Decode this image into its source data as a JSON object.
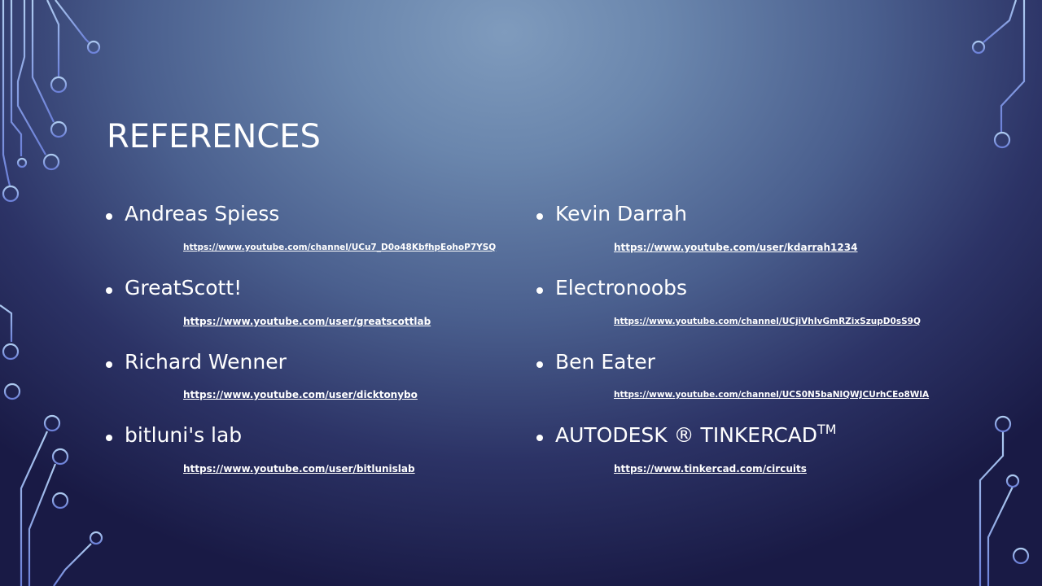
{
  "slide": {
    "title": "REFERENCES"
  },
  "left_column": [
    {
      "name": "Andreas Spiess",
      "url": "https://www.youtube.com/channel/UCu7_D0o48KbfhpEohoP7YSQ"
    },
    {
      "name": "GreatScott!",
      "url": "https://www.youtube.com/user/greatscottlab"
    },
    {
      "name": "Richard Wenner",
      "url": "https://www.youtube.com/user/dicktonybo"
    },
    {
      "name": "bitluni's lab",
      "url": "https://www.youtube.com/user/bitlunislab"
    }
  ],
  "right_column": [
    {
      "name": "Kevin Darrah",
      "url": "https://www.youtube.com/user/kdarrah1234"
    },
    {
      "name": "Electronoobs",
      "url": "https://www.youtube.com/channel/UCjiVhIvGmRZixSzupD0sS9Q"
    },
    {
      "name": "Ben Eater",
      "url": "https://www.youtube.com/channel/UCS0N5baNlQWJCUrhCEo8WlA"
    },
    {
      "name": "AUTODESK ® TINKERCAD",
      "name_suffix": "TM",
      "url": "https://www.tinkercad.com/circuits"
    }
  ],
  "colors": {
    "background_center": "#7f9bbd",
    "background_edge": "#191a45",
    "text": "#ffffff",
    "circuit_lines_top": "#a9c6ec",
    "circuit_lines_bottom": "#6f86d6"
  }
}
